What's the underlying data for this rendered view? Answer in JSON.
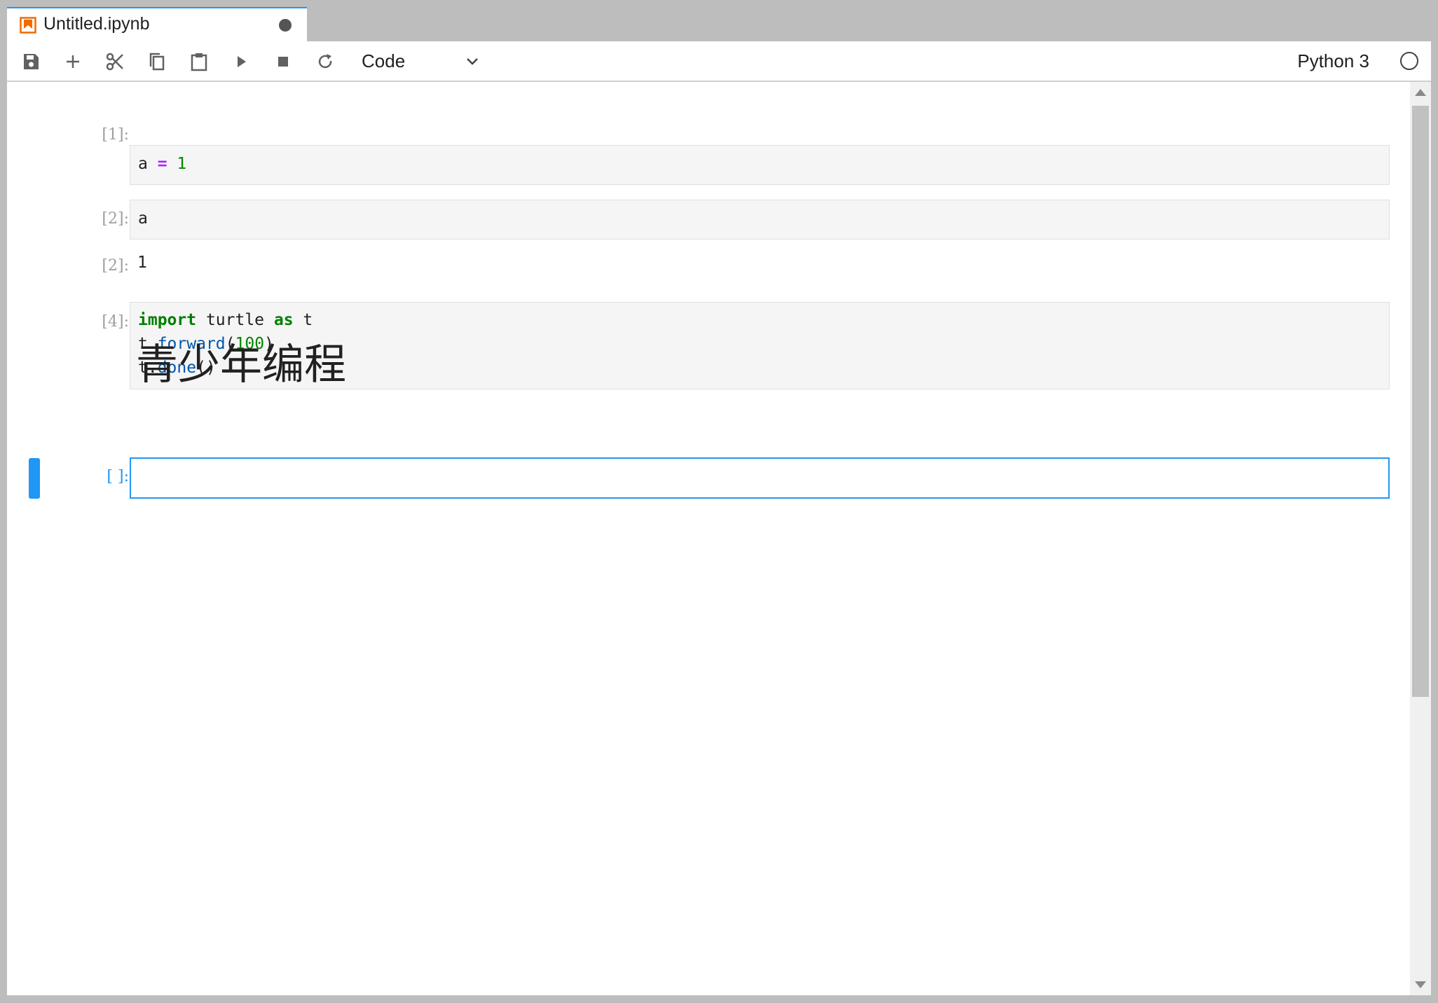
{
  "tab": {
    "title": "Untitled.ipynb",
    "icon": "notebook-icon",
    "dirty": true
  },
  "toolbar": {
    "buttons": [
      "save-icon",
      "add-icon",
      "cut-icon",
      "copy-icon",
      "paste-icon",
      "run-icon",
      "stop-icon",
      "restart-icon"
    ],
    "cell_type": "Code",
    "kernel_name": "Python 3",
    "kernel_status": "idle"
  },
  "cells": [
    {
      "prompt": "[1]:",
      "code": [
        "a = 1"
      ]
    },
    {
      "prompt": "[2]:",
      "code": [
        "a"
      ],
      "output_prompt": "[2]:",
      "output": "1"
    },
    {
      "prompt": "[4]:",
      "code": [
        "import turtle as t",
        "t.forward(100)",
        "t.done()"
      ]
    },
    {
      "markdown": "青少年编程"
    },
    {
      "prompt": "[ ]:",
      "code": [
        ""
      ]
    }
  ],
  "colors": {
    "accent": "#2196f3",
    "keyword": "#008000",
    "operator": "#aa22ff",
    "function": "#0055aa"
  }
}
